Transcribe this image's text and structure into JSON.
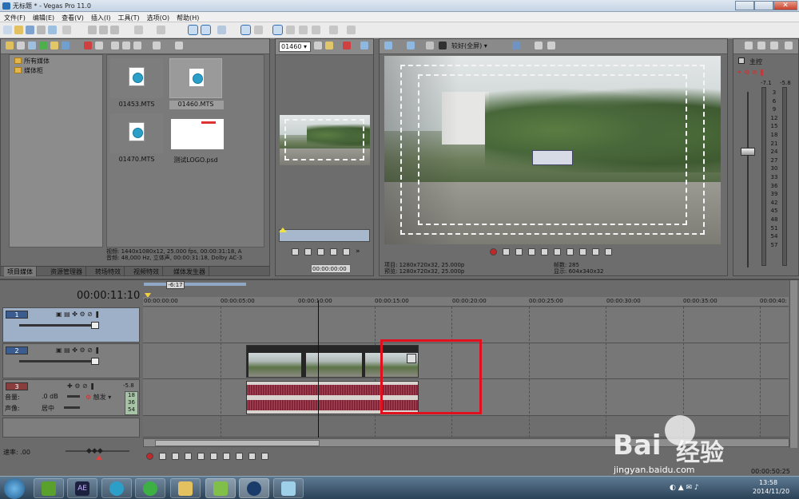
{
  "window": {
    "title": "无标题 * - Vegas Pro 11.0"
  },
  "menu": [
    "文件(F)",
    "编辑(E)",
    "查看(V)",
    "插入(I)",
    "工具(T)",
    "选项(O)",
    "帮助(H)"
  ],
  "explorer": {
    "tree": [
      "所有媒体",
      "媒体柜"
    ],
    "files": [
      {
        "name": "01453.MTS",
        "type": "video"
      },
      {
        "name": "01460.MTS",
        "type": "video",
        "selected": true
      },
      {
        "name": "01470.MTS",
        "type": "video"
      },
      {
        "name": "测试LOGO.psd",
        "type": "image"
      }
    ],
    "info_line1": "视频: 1440x1080x12, 25.000 fps, 00:00:31:18, A",
    "info_line2": "音频: 48,000 Hz, 立体声, 00:00:31:18, Dolby AC-3",
    "tabs": [
      "项目媒体",
      "资源管理器",
      "转场特效",
      "视频特效",
      "媒体发生器"
    ]
  },
  "trimmer": {
    "clip_select": "01460",
    "timecode": "00:00:00:00"
  },
  "preview": {
    "quality": "较好(全屏)",
    "project_label": "项目: 1280x720x32, 25.000p",
    "preview_label": "预览: 1280x720x32, 25.000p",
    "frame_label": "帧数: 285",
    "display_label": "显示: 604x340x32"
  },
  "mixer": {
    "title": "主控",
    "top_values": [
      "-7.1",
      "-5.8"
    ],
    "scale": [
      "3",
      "6",
      "9",
      "12",
      "15",
      "18",
      "21",
      "24",
      "27",
      "30",
      "33",
      "36",
      "39",
      "42",
      "45",
      "48",
      "51",
      "54",
      "57"
    ]
  },
  "timeline": {
    "timecode": "00:00:11:10",
    "loop_marker": "-6:17",
    "ruler": [
      "00:00:00:00",
      "00:00:05:00",
      "00:00:10:00",
      "00:00:15:00",
      "00:00:20:00",
      "00:00:25:00",
      "00:00:30:00",
      "00:00:35:00",
      "00:00:40:"
    ],
    "tracks": [
      {
        "number": "1",
        "kind": "video"
      },
      {
        "number": "2",
        "kind": "video"
      },
      {
        "number": "3",
        "kind": "audio",
        "volume_label": "音量:",
        "volume_value": ".0 dB",
        "pan_label": "声像:",
        "pan_value": "居中",
        "mode": "触发",
        "meter_top": "-5.8",
        "meter_vals": [
          "18",
          "36",
          "54"
        ]
      }
    ],
    "rate_label": "速率: .00",
    "bottom_time": "00:00:50:25"
  },
  "taskbar": {
    "time": "13:58",
    "date": "2014/11/20",
    "ae_label": "AE"
  },
  "watermark": {
    "brand": "Bai",
    "text": "经验",
    "url": "jingyan.baidu.com"
  }
}
